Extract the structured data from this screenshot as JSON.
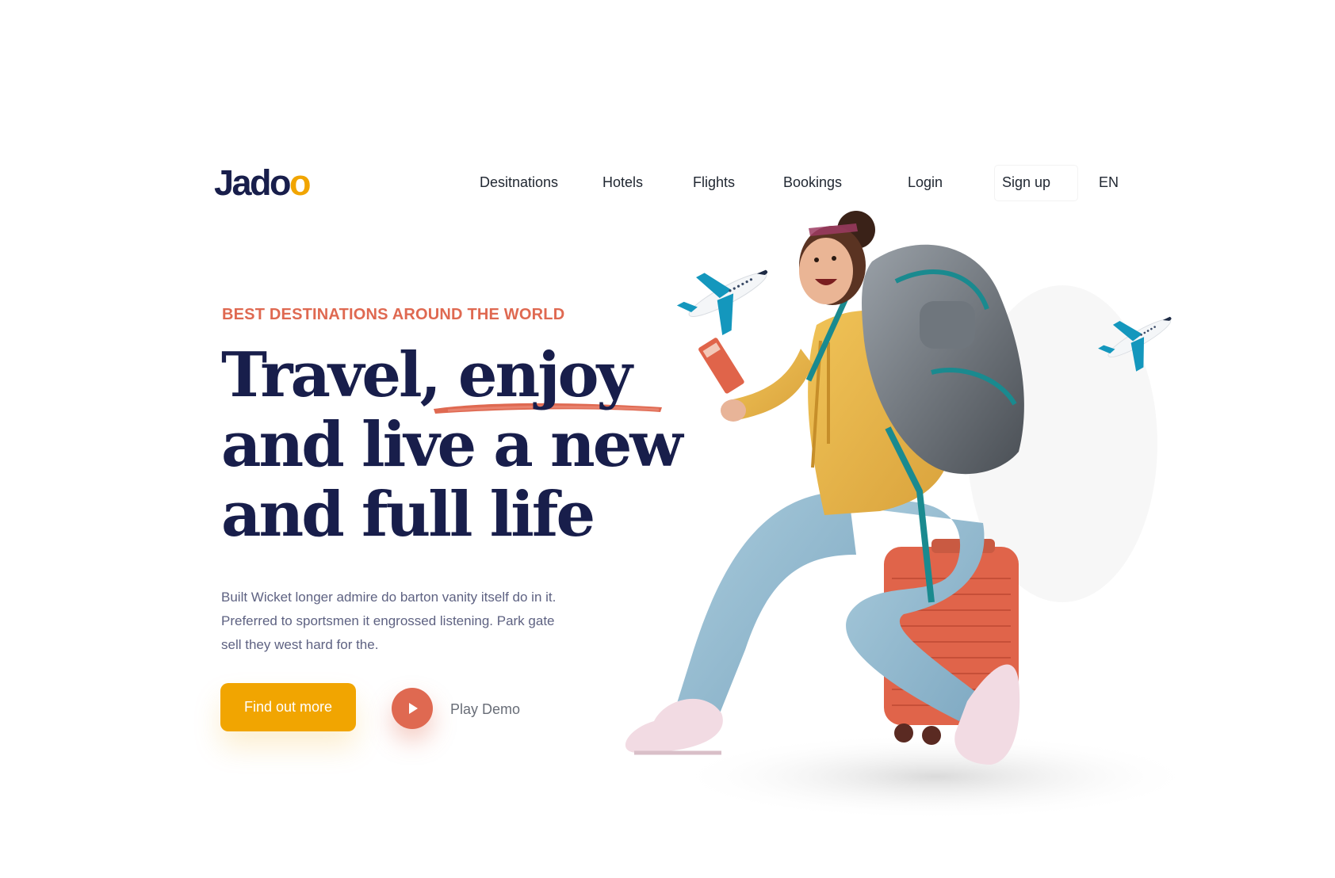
{
  "brand": {
    "logo_text": "Jadoo",
    "logo_main": "Jad",
    "logo_o1": "o",
    "logo_o2": "o"
  },
  "nav": {
    "items": [
      "Desitnations",
      "Hotels",
      "Flights",
      "Bookings"
    ],
    "login": "Login",
    "signup": "Sign up",
    "language": "EN"
  },
  "hero": {
    "kicker": "BEST DESTINATIONS AROUND THE WORLD",
    "headline_lines": [
      "Travel, enjoy",
      "and live a new",
      "and full life"
    ],
    "description_lines": [
      "Built Wicket longer admire do barton vanity itself do in it.",
      "Preferred to sportsmen it engrossed listening. Park gate",
      "sell they west hard for the."
    ],
    "primary_button": "Find out more",
    "secondary_button": "Play Demo"
  },
  "colors": {
    "navy": "#181E4B",
    "accent_orange": "#DF6951",
    "accent_yellow": "#F1A501",
    "body_text": "#5E6282"
  }
}
